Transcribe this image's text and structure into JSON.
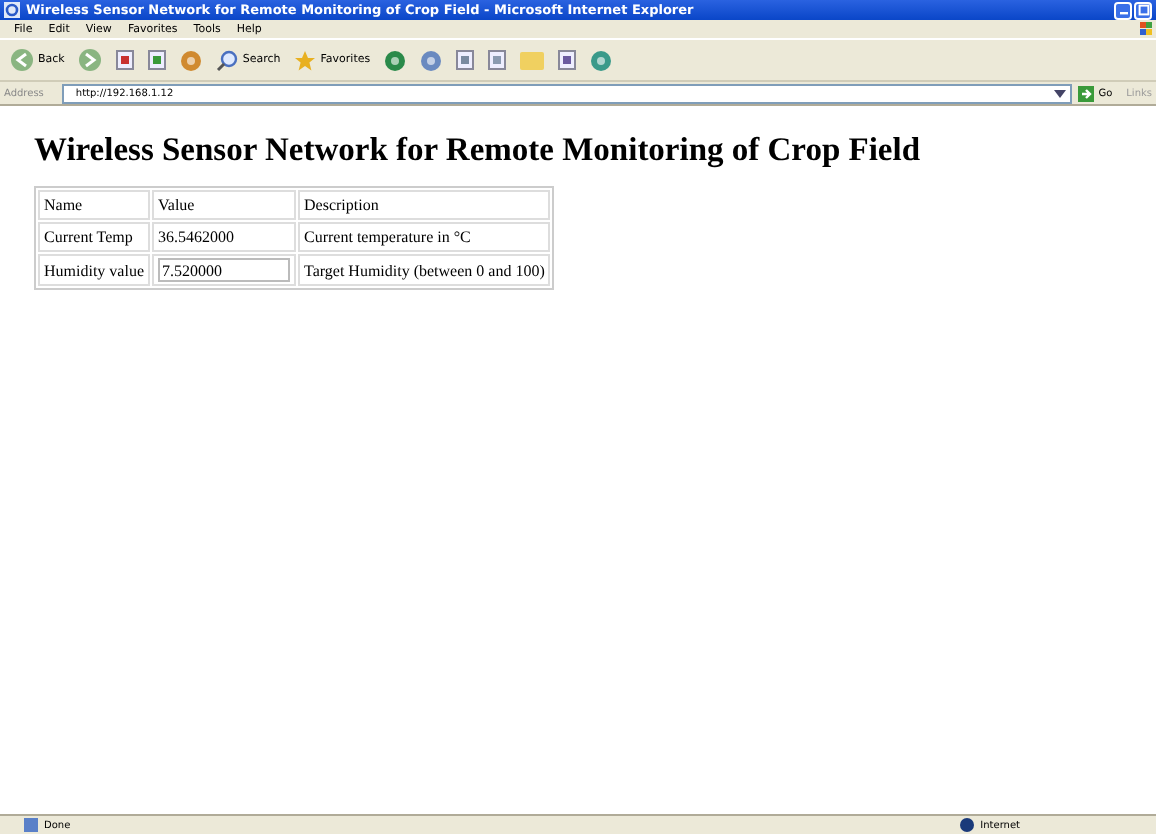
{
  "window": {
    "title": "Wireless Sensor Network for Remote Monitoring of Crop Field - Microsoft Internet Explorer"
  },
  "menu": [
    "File",
    "Edit",
    "View",
    "Favorites",
    "Tools",
    "Help"
  ],
  "toolbar": [
    {
      "kind": "back",
      "label": "Back"
    },
    {
      "kind": "forward"
    },
    {
      "kind": "stop"
    },
    {
      "kind": "refresh"
    },
    {
      "kind": "home"
    },
    {
      "kind": "search",
      "label": "Search"
    },
    {
      "kind": "favorites",
      "label": "Favorites"
    },
    {
      "kind": "history"
    },
    {
      "kind": "mail"
    },
    {
      "kind": "print"
    },
    {
      "kind": "edit"
    },
    {
      "kind": "folder"
    },
    {
      "kind": "book"
    },
    {
      "kind": "messenger"
    }
  ],
  "address_bar": {
    "label": "Address",
    "value": "http://192.168.1.12",
    "go": "Go",
    "links": "Links"
  },
  "page": {
    "heading": "Wireless Sensor Network for Remote Monitoring of Crop Field",
    "table": {
      "columns": [
        "Name",
        "Value",
        "Description"
      ],
      "rows": [
        {
          "name": "Current Temp",
          "value": "36.5462000",
          "kind": "text",
          "description": "Current temperature in °C"
        },
        {
          "name": "Humidity value",
          "value": "7.520000",
          "kind": "input",
          "description": "Target Humidity (between 0 and 100)"
        }
      ]
    }
  },
  "status_bar": {
    "status": "Done",
    "zone": "Internet"
  }
}
